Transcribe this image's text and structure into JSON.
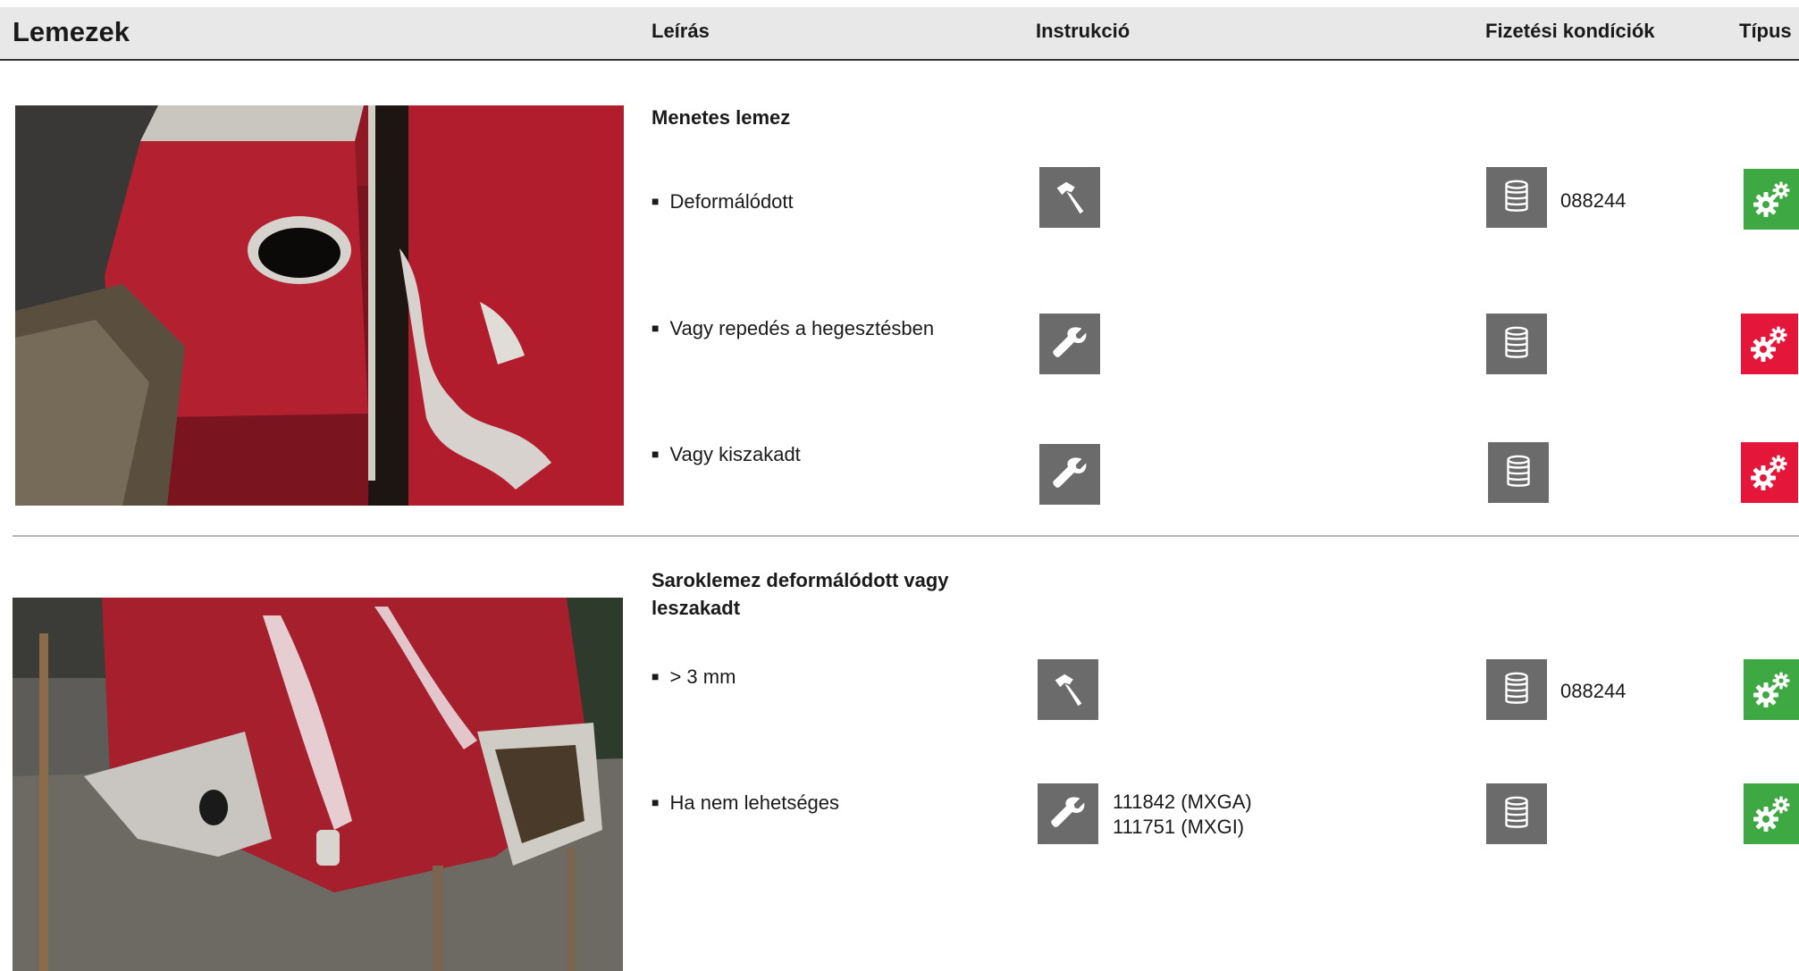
{
  "header": {
    "title": "Lemezek",
    "col_description": "Leírás",
    "col_instruction": "Instrukció",
    "col_payment": "Fizetési kondíciók",
    "col_type": "Típus"
  },
  "colors": {
    "type_green": "#3ea843",
    "type_red": "#e4173a",
    "icon_gray": "#6b6b6b"
  },
  "sections": [
    {
      "title": "Menetes lemez",
      "items": [
        {
          "label": "Deformálódott",
          "instruction_icon": "hammer-icon",
          "instruction_code": "",
          "payment_icon": "coin-stack-icon",
          "payment_code": "088244",
          "type": "green"
        },
        {
          "label": "Vagy repedés a hegesztésben",
          "instruction_icon": "wrench-icon",
          "instruction_code": "",
          "payment_icon": "coin-stack-icon",
          "payment_code": "",
          "type": "red"
        },
        {
          "label": "Vagy kiszakadt",
          "instruction_icon": "wrench-icon",
          "instruction_code": "",
          "payment_icon": "coin-stack-icon",
          "payment_code": "",
          "type": "red"
        }
      ]
    },
    {
      "title_line1": "Saroklemez deformálódott vagy",
      "title_line2": "leszakadt",
      "items": [
        {
          "label": "> 3 mm",
          "instruction_icon": "hammer-icon",
          "instruction_code": "",
          "payment_icon": "coin-stack-icon",
          "payment_code": "088244",
          "type": "green"
        },
        {
          "label": "Ha nem lehetséges",
          "instruction_icon": "wrench-icon",
          "instruction_code_line1": "111842 (MXGA)",
          "instruction_code_line2": "111751 (MXGI)",
          "payment_icon": "coin-stack-icon",
          "payment_code": "",
          "type": "green"
        }
      ]
    }
  ],
  "bullet": "■"
}
